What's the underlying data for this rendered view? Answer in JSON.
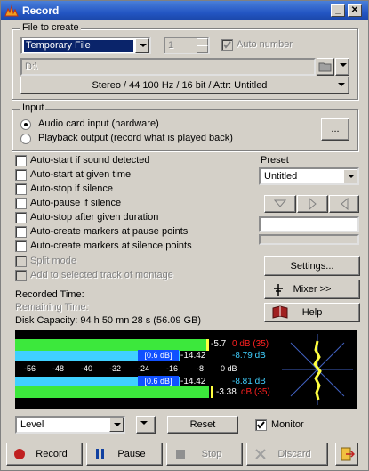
{
  "window": {
    "title": "Record"
  },
  "file_group": {
    "label": "File to create",
    "file_type": "Temporary File",
    "number_value": "1",
    "auto_number_label": "Auto number",
    "path": "D:\\",
    "format": "Stereo / 44 100 Hz / 16 bit / Attr: Untitled"
  },
  "input_group": {
    "label": "Input",
    "option_card": "Audio card input (hardware)",
    "option_playback": "Playback output (record what is played back)",
    "more_button": "..."
  },
  "options": [
    {
      "label": "Auto-start if sound detected",
      "checked": false,
      "enabled": true
    },
    {
      "label": "Auto-start at given time",
      "checked": false,
      "enabled": true
    },
    {
      "label": "Auto-stop if silence",
      "checked": false,
      "enabled": true
    },
    {
      "label": "Auto-pause if silence",
      "checked": false,
      "enabled": true
    },
    {
      "label": "Auto-stop after given duration",
      "checked": false,
      "enabled": true
    },
    {
      "label": "Auto-create markers at pause points",
      "checked": false,
      "enabled": true
    },
    {
      "label": "Auto-create markers at silence points",
      "checked": false,
      "enabled": true
    },
    {
      "label": "Split mode",
      "checked": false,
      "enabled": false
    },
    {
      "label": "Add to selected track of montage",
      "checked": false,
      "enabled": false
    }
  ],
  "preset": {
    "label": "Preset",
    "value": "Untitled"
  },
  "side_buttons": {
    "settings": "Settings...",
    "mixer": "Mixer >>",
    "help": "Help"
  },
  "status": {
    "recorded_time": "Recorded Time:",
    "remaining_time": "Remaining Time:",
    "disk_capacity": "Disk Capacity: 94 h 50 mn 28 s (56.09 GB)"
  },
  "meter": {
    "ch1_peak": "-5.7",
    "ch1_peak_db": "0 dB (35)",
    "ch1_box": "[0.6 dB]",
    "ch1_avg": "-14.42",
    "ch1_rms": "-8.79 dB",
    "ch2_box": "[0.6 dB]",
    "ch2_avg": "-14.42",
    "ch2_rms": "-8.81 dB",
    "ch2_peak": "-3.38",
    "ch2_peak_db": "dB (35)",
    "scale": [
      "-56",
      "-48",
      "-40",
      "-32",
      "-24",
      "-16",
      "-8",
      "0 dB"
    ],
    "ch1_level": 0.83,
    "ch2_level": 0.84,
    "colors": {
      "bar": "#3ce83c",
      "cyan": "#40d0ff",
      "red": "#ff2020",
      "peak": "#ffff40",
      "blue_box": "#1050ff"
    }
  },
  "bottom": {
    "display_mode": "Level",
    "reset": "Reset",
    "monitor": "Monitor"
  },
  "actions": {
    "record": "Record",
    "pause": "Pause",
    "stop": "Stop",
    "discard": "Discard"
  }
}
